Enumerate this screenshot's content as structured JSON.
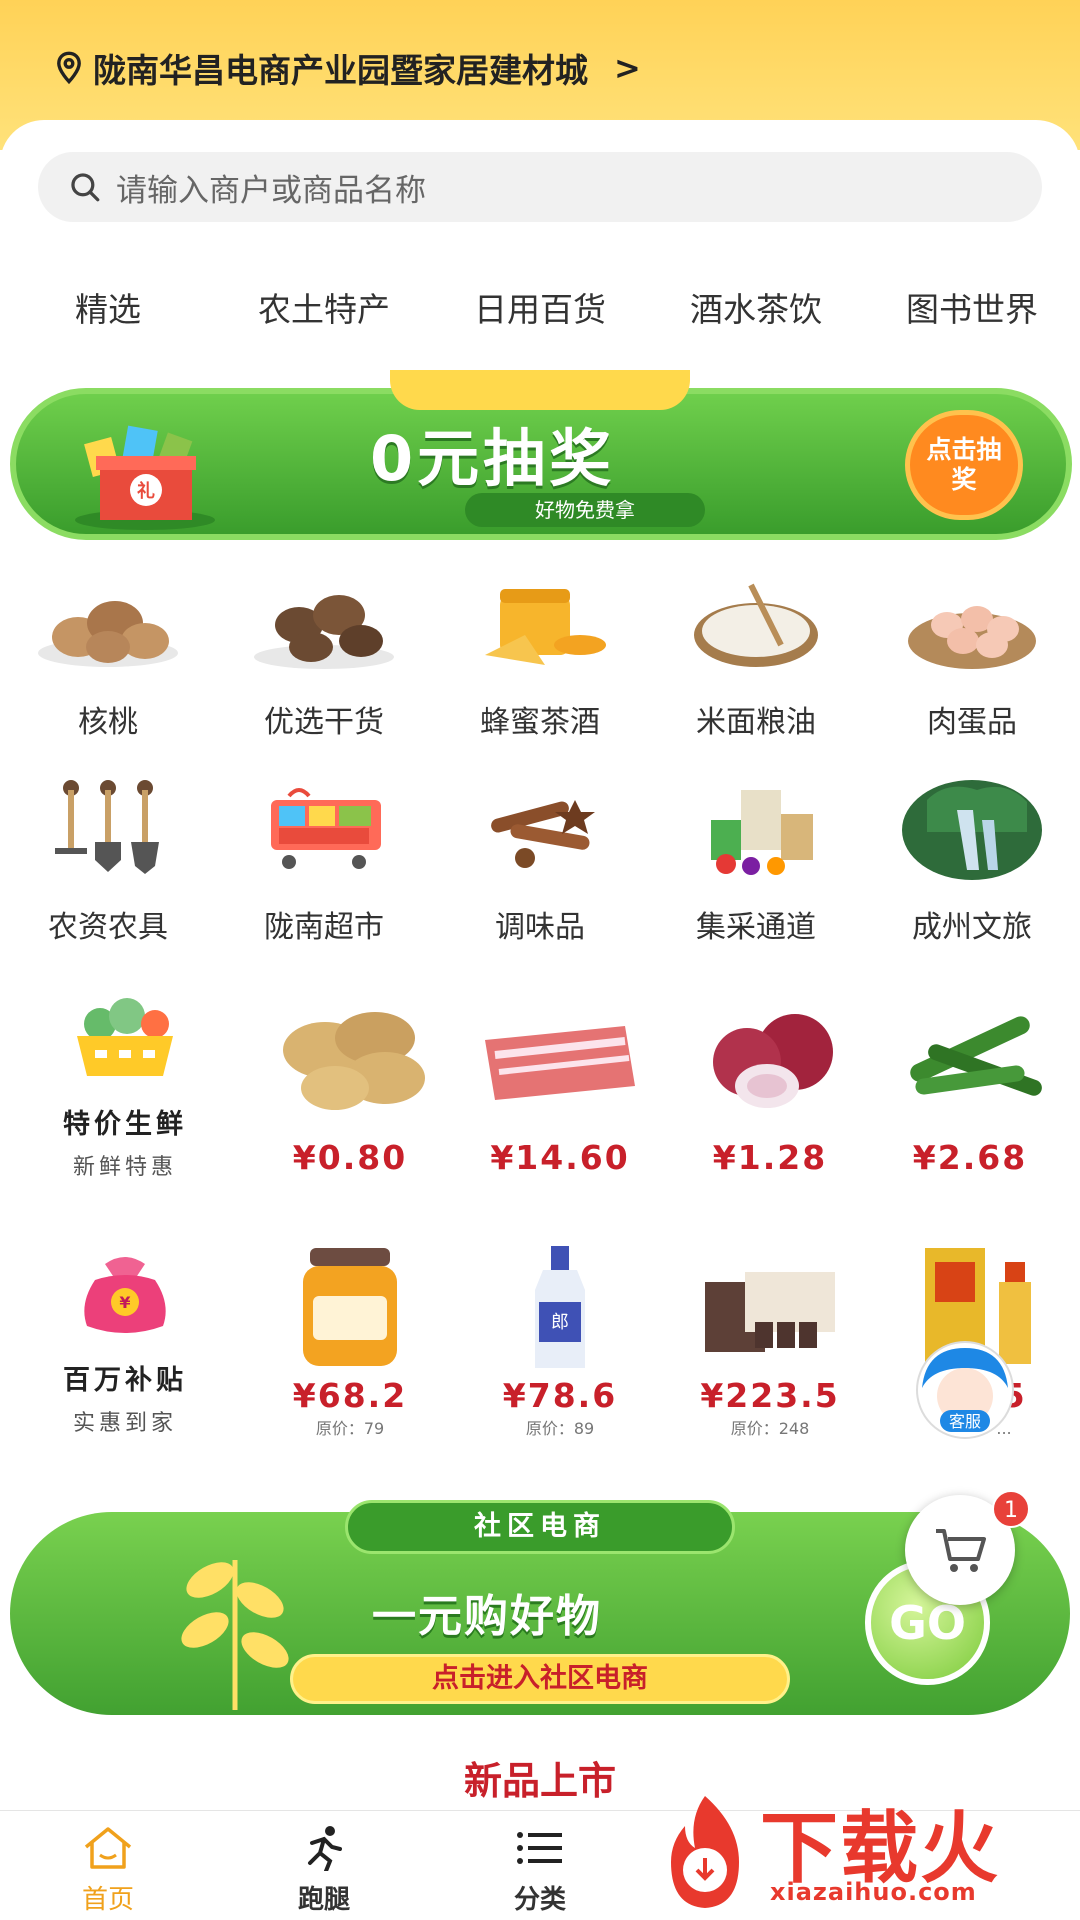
{
  "header": {
    "location": "陇南华昌电商产业园暨家居建材城",
    "location_chevron": ">"
  },
  "search": {
    "placeholder": "请输入商户或商品名称"
  },
  "tabs": [
    "精选",
    "农土特产",
    "日用百货",
    "酒水茶饮",
    "图书世界"
  ],
  "lottery": {
    "title": "0元抽奖",
    "subtitle": "好物免费拿",
    "gift_label": "礼",
    "button": "点击抽奖"
  },
  "categories_row1": [
    "核桃",
    "优选干货",
    "蜂蜜茶酒",
    "米面粮油",
    "肉蛋品"
  ],
  "categories_row2": [
    "农资农具",
    "陇南超市",
    "调味品",
    "集采通道",
    "成州文旅"
  ],
  "fresh_deal": {
    "title": "特价生鲜",
    "subtitle": "新鲜特惠",
    "items": [
      {
        "name": "potato",
        "price": "¥0.80"
      },
      {
        "name": "meat",
        "price": "¥14.60"
      },
      {
        "name": "onion",
        "price": "¥1.28"
      },
      {
        "name": "cucumber",
        "price": "¥2.68"
      }
    ]
  },
  "subsidy_deal": {
    "title": "百万补贴",
    "subtitle": "实惠到家",
    "icon_label": "¥",
    "items": [
      {
        "name": "honey-jar",
        "price": "¥68.2",
        "original": "原价：79"
      },
      {
        "name": "liquor-bottle",
        "price": "¥78.6",
        "original": "原价：89",
        "label": "郎"
      },
      {
        "name": "tea-set",
        "price": "¥223.5",
        "original": "原价：248"
      },
      {
        "name": "liquor-gift-box",
        "price": "¥...5",
        "original": "原价：..."
      }
    ]
  },
  "community": {
    "pill": "社区电商",
    "title": "一元购好物",
    "cta": "点击进入社区电商",
    "go": "GO"
  },
  "section_title": "新品上市",
  "floating": {
    "kefu": "客服",
    "cart_badge": "1"
  },
  "nav": [
    {
      "label": "首页",
      "icon": "home-icon",
      "active": true
    },
    {
      "label": "跑腿",
      "icon": "runner-icon",
      "active": false
    },
    {
      "label": "分类",
      "icon": "list-icon",
      "active": false
    }
  ],
  "watermark": {
    "brand": "下载火",
    "url": "xiazaihuo.com"
  },
  "colors": {
    "accent": "#ffd257",
    "price": "#c8202a",
    "green": "#4caf3a",
    "nav_active": "#f0a11c"
  }
}
